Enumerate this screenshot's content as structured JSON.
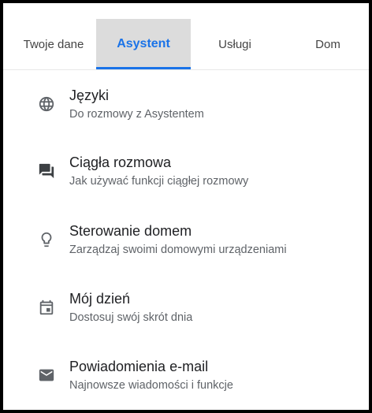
{
  "tabs": [
    {
      "label": "Twoje dane",
      "active": false
    },
    {
      "label": "Asystent",
      "active": true
    },
    {
      "label": "Usługi",
      "active": false
    },
    {
      "label": "Dom",
      "active": false
    }
  ],
  "accent_color": "#1a73e8",
  "items": [
    {
      "icon": "globe-icon",
      "title": "Języki",
      "subtitle": "Do rozmowy z Asystentem"
    },
    {
      "icon": "chat-bubble-icon",
      "title": "Ciągła rozmowa",
      "subtitle": "Jak używać funkcji ciągłej rozmowy"
    },
    {
      "icon": "lightbulb-icon",
      "title": "Sterowanie domem",
      "subtitle": "Zarządzaj swoimi domowymi urządzeniami"
    },
    {
      "icon": "calendar-icon",
      "title": "Mój dzień",
      "subtitle": "Dostosuj swój skrót dnia"
    },
    {
      "icon": "email-icon",
      "title": "Powiadomienia e-mail",
      "subtitle": "Najnowsze wiadomości i funkcje"
    }
  ]
}
